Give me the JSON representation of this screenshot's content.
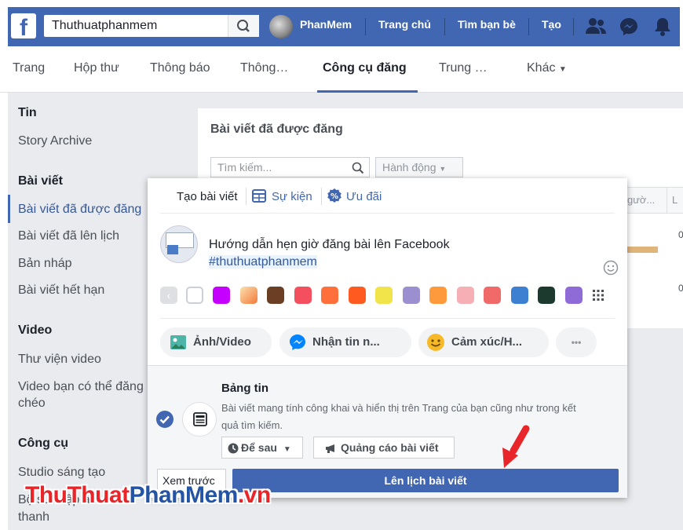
{
  "topbar": {
    "search_value": "Thuthuatphanmem",
    "user_name": "PhanMem",
    "nav": [
      "Trang chủ",
      "Tìm bạn bè",
      "Tạo"
    ],
    "brand_color": "#4267b2"
  },
  "tabs": [
    "Trang",
    "Hộp thư",
    "Thông báo",
    "Thông…",
    "Công cụ đăng",
    "Trung …",
    "Khác"
  ],
  "sidebar": {
    "sections": [
      {
        "title": "Tin",
        "items": [
          "Story Archive"
        ]
      },
      {
        "title": "Bài viết",
        "items": [
          "Bài viết đã được đăng",
          "Bài viết đã lên lịch",
          "Bản nháp",
          "Bài viết hết hạn"
        ]
      },
      {
        "title": "Video",
        "items": [
          "Thư viện video",
          "Video bạn có thể đăng",
          "chéo"
        ]
      },
      {
        "title": "Công cụ",
        "items": [
          "Studio sáng tạo",
          "Bộ sưu tập âm",
          "thanh"
        ]
      }
    ]
  },
  "panel": {
    "title": "Bài viết đã được đăng",
    "search_placeholder": "Tìm kiếm...",
    "action_label": "Hành động",
    "columns": [
      "gườ...",
      "L"
    ],
    "row_values": [
      "0",
      "0"
    ]
  },
  "dialog": {
    "tabs": [
      "Tạo bài viết",
      "Sự kiện",
      "Ưu đãi"
    ],
    "post_text_line1": "Hướng dẫn hẹn giờ đăng bài lên Facebook",
    "post_hashtag": "#thuthuatphanmem",
    "actions": [
      "Ảnh/Video",
      "Nhận tin n...",
      "Cảm xúc/H..."
    ],
    "more_label": "•••",
    "feed_title": "Bảng tin",
    "feed_desc_1": "Bài viết mang tính công khai và hiển thị trên Trang của bạn cũng như trong kết",
    "feed_desc_2": "quả tìm kiếm.",
    "schedule_label": "Để sau",
    "promote_label": "Quảng cáo bài viết",
    "preview_label": "Xem trước",
    "submit_label": "Lên lịch bài viết"
  },
  "watermark": {
    "part1": "ThuThuat",
    "part2": "PhanMem",
    "part3": ".vn"
  },
  "colors": {
    "accent": "#4267b2",
    "arrow": "#e8262a",
    "background": "#e9ebee"
  }
}
